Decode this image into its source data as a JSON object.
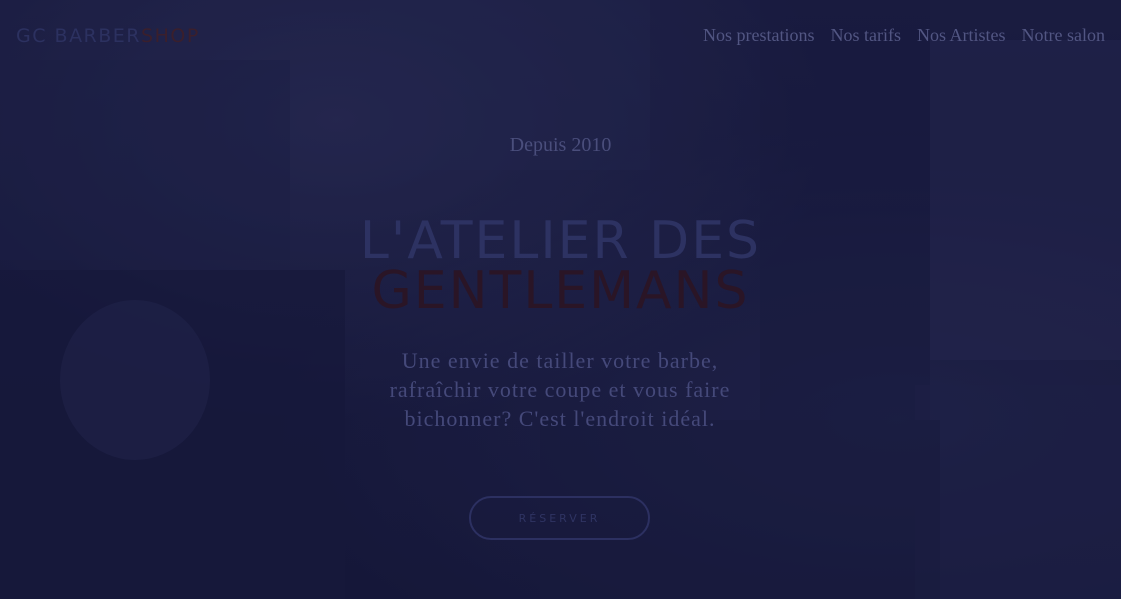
{
  "header": {
    "logo_part1": "GC BARBER",
    "logo_part2": "SHOP",
    "nav": [
      {
        "label": "Nos prestations"
      },
      {
        "label": "Nos tarifs"
      },
      {
        "label": "Nos Artistes"
      },
      {
        "label": "Notre salon"
      }
    ]
  },
  "hero": {
    "since": "Depuis 2010",
    "title_line1": "L'ATELIER DES",
    "title_line2": "GENTLEMANS",
    "tagline": "Une envie de tailler votre barbe, rafraîchir votre coupe et vous faire bichonner? C'est l'endroit idéal.",
    "cta_label": "RÉSERVER"
  },
  "colors": {
    "background": "#171a3a",
    "accent": "#3a1f2c",
    "text_muted": "#525683"
  }
}
